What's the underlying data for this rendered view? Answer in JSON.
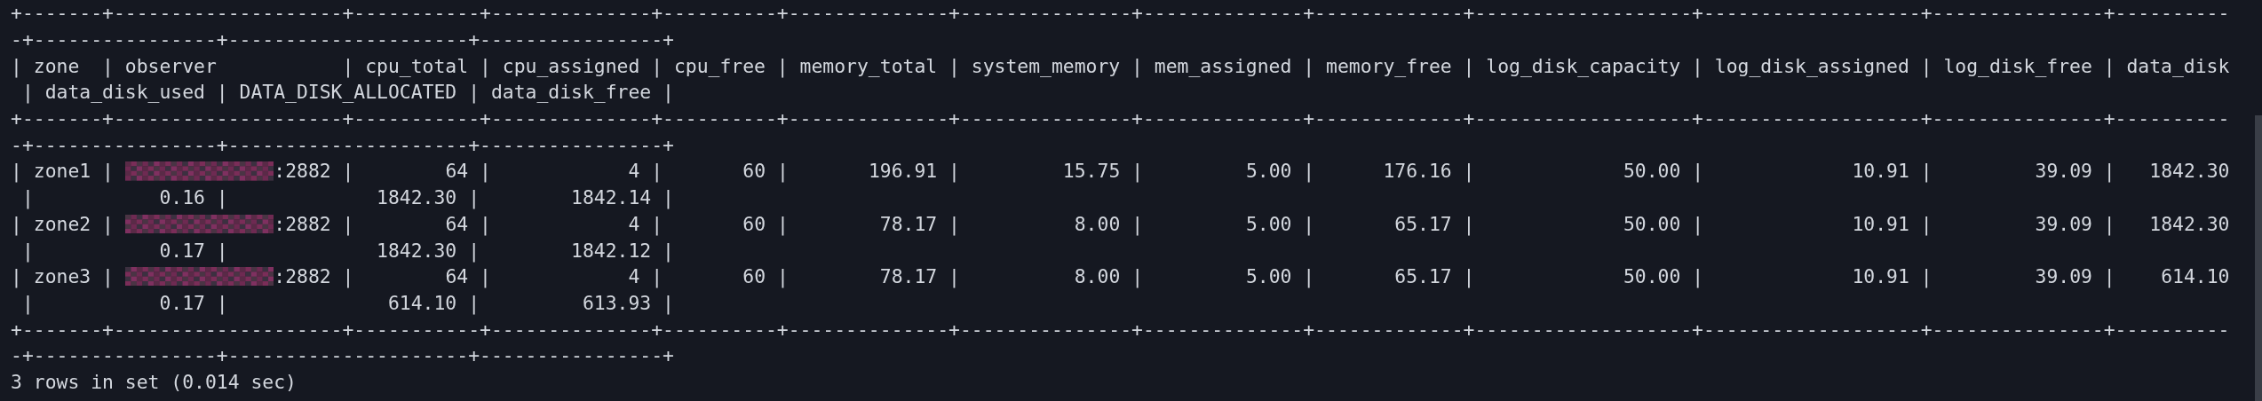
{
  "terminal": {
    "lines": [
      {
        "kind": "border",
        "text": "+-------+--------------------+-----------+--------------+----------+--------------+---------------+--------------+-------------+-------------------+-------------------+---------------+----------"
      },
      {
        "kind": "border",
        "text": "-+----------------+---------------------+----------------+"
      },
      {
        "kind": "header",
        "text": "| zone  | observer           | cpu_total | cpu_assigned | cpu_free | memory_total | system_memory | mem_assigned | memory_free | log_disk_capacity | log_disk_assigned | log_disk_free | data_disk"
      },
      {
        "kind": "header",
        "text": " | data_disk_used | DATA_DISK_ALLOCATED | data_disk_free |"
      },
      {
        "kind": "border",
        "text": "+-------+--------------------+-----------+--------------+----------+--------------+---------------+--------------+-------------+-------------------+-------------------+---------------+----------"
      },
      {
        "kind": "border",
        "text": "-+----------------+---------------------+----------------+"
      },
      {
        "kind": "redacted",
        "before": "| zone1 | ",
        "after": ":2882 |        64 |            4 |       60 |       196.91 |         15.75 |         5.00 |      176.16 |             50.00 |             10.91 |         39.09 |   1842.30"
      },
      {
        "kind": "row",
        "text": " |           0.16 |             1842.30 |        1842.14 |"
      },
      {
        "kind": "redacted",
        "before": "| zone2 | ",
        "after": ":2882 |        64 |            4 |       60 |        78.17 |          8.00 |         5.00 |       65.17 |             50.00 |             10.91 |         39.09 |   1842.30"
      },
      {
        "kind": "row",
        "text": " |           0.17 |             1842.30 |        1842.12 |"
      },
      {
        "kind": "redacted",
        "before": "| zone3 | ",
        "after": ":2882 |        64 |            4 |       60 |        78.17 |          8.00 |         5.00 |       65.17 |             50.00 |             10.91 |         39.09 |    614.10"
      },
      {
        "kind": "row",
        "text": " |           0.17 |              614.10 |         613.93 |"
      },
      {
        "kind": "border",
        "text": "+-------+--------------------+-----------+--------------+----------+--------------+---------------+--------------+-------------+-------------------+-------------------+---------------+----------"
      },
      {
        "kind": "border",
        "text": "-+----------------+---------------------+----------------+"
      },
      {
        "kind": "status",
        "text": "3 rows in set (0.014 sec)"
      }
    ]
  }
}
